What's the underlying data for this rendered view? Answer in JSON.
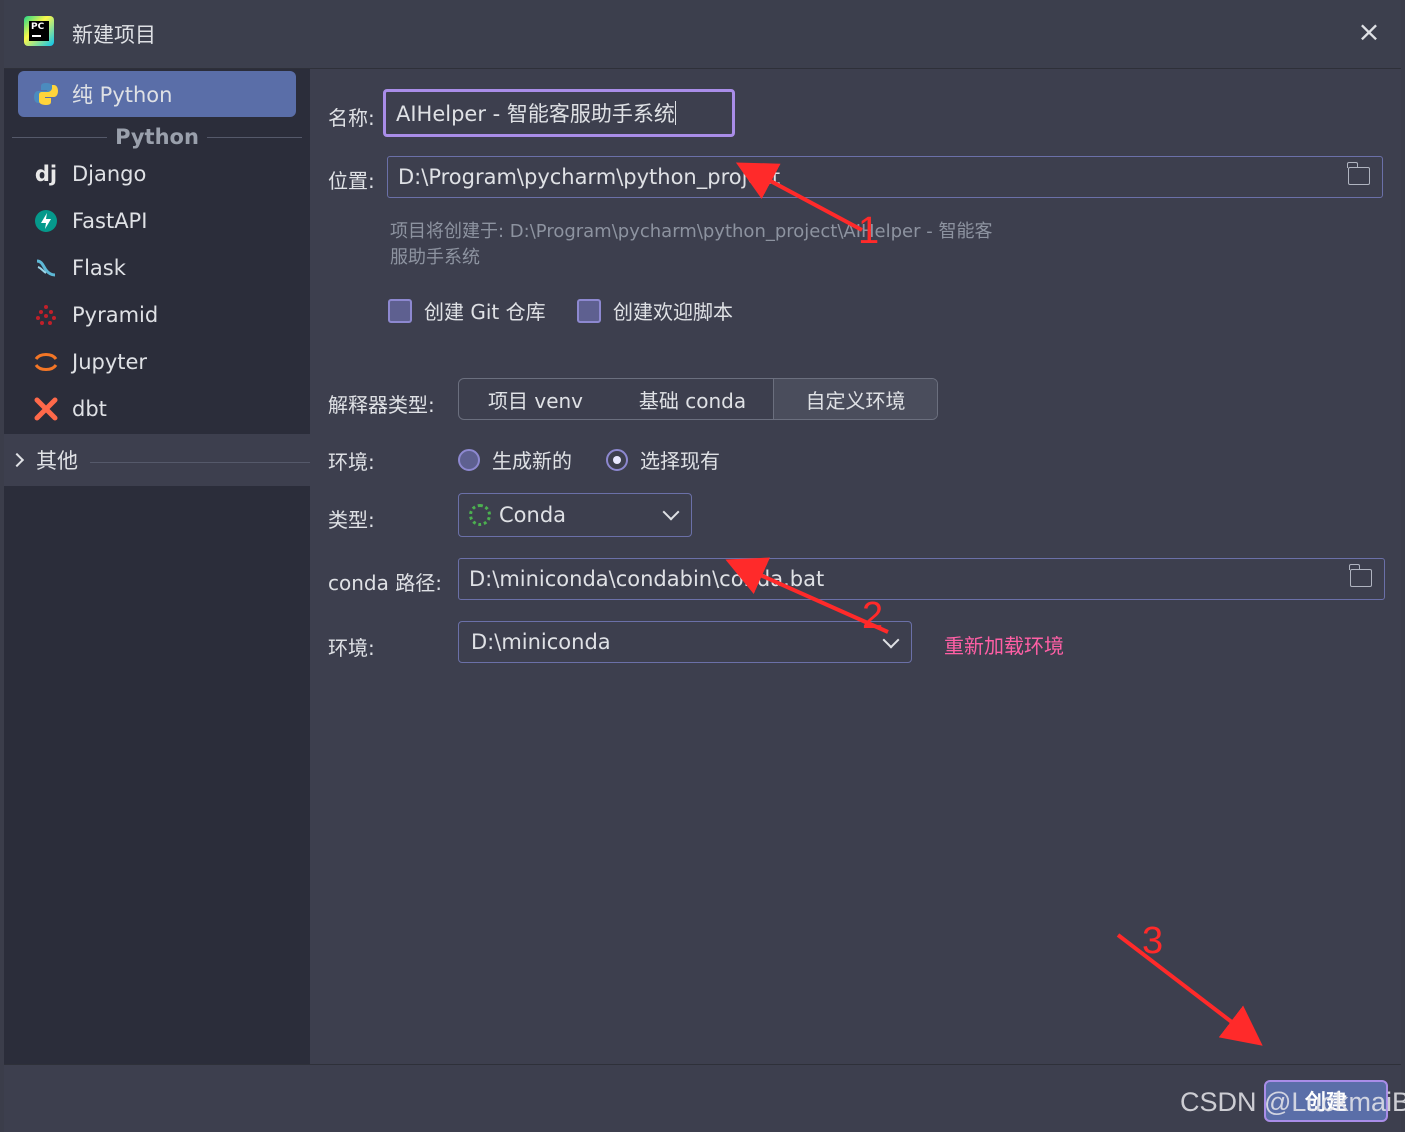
{
  "window": {
    "title": "新建项目",
    "close_symbol": "×"
  },
  "sidebar": {
    "selected": {
      "label": "纯 Python",
      "icon": "python-icon"
    },
    "section_label": "Python",
    "items": [
      {
        "label": "Django",
        "icon": "django-icon",
        "glyph": "dj"
      },
      {
        "label": "FastAPI",
        "icon": "fastapi-icon"
      },
      {
        "label": "Flask",
        "icon": "flask-icon"
      },
      {
        "label": "Pyramid",
        "icon": "pyramid-icon"
      },
      {
        "label": "Jupyter",
        "icon": "jupyter-icon"
      },
      {
        "label": "dbt",
        "icon": "dbt-icon"
      }
    ],
    "other_label": "其他"
  },
  "form": {
    "name_label": "名称:",
    "name_value": "AIHelper - 智能客服助手系统",
    "location_label": "位置:",
    "location_value": "D:\\Program\\pycharm\\python_project",
    "hint_line1": "项目将创建于: D:\\Program\\pycharm\\python_project\\AIHelper - 智能客",
    "hint_line2": "服助手系统",
    "git_checkbox_label": "创建 Git 仓库",
    "welcome_checkbox_label": "创建欢迎脚本",
    "interpreter_type_label": "解释器类型:",
    "interpreter_tabs": [
      "项目 venv",
      "基础 conda",
      "自定义环境"
    ],
    "active_interpreter_tab": "自定义环境",
    "env_label": "环境:",
    "env_options": [
      "生成新的",
      "选择现有"
    ],
    "env_selected": "选择现有",
    "type_label": "类型:",
    "type_value": "Conda",
    "conda_path_label": "conda 路径:",
    "conda_path_value": "D:\\miniconda\\condabin\\conda.bat",
    "env2_label": "环境:",
    "env2_value": "D:\\miniconda",
    "reload_link": "重新加载环境"
  },
  "footer": {
    "create_button": "创建"
  },
  "watermark": "CSDN @LuckmaiB",
  "annotations": {
    "color": "#ff2a2a",
    "labels": [
      "1",
      "2",
      "3"
    ]
  }
}
